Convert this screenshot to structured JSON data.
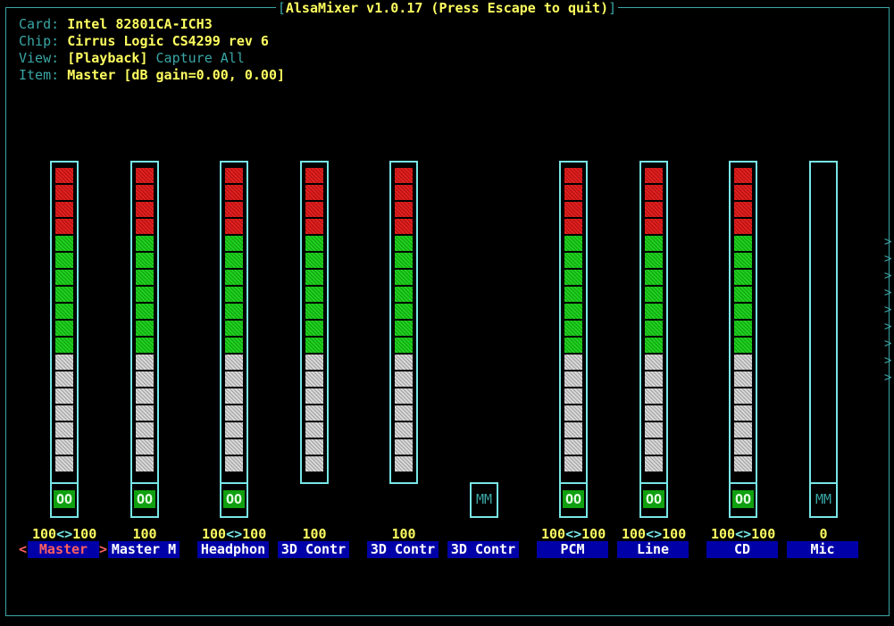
{
  "window": {
    "title": "AlsaMixer v1.0.17 (Press Escape to quit)"
  },
  "info": {
    "card_label": "Card:",
    "card_value": "Intel 82801CA-ICH3",
    "chip_label": "Chip:",
    "chip_value": "Cirrus Logic CS4299 rev 6",
    "view_label": "View:",
    "view_active": "[Playback]",
    "view_capture": "Capture",
    "view_all": "All",
    "item_label": "Item:",
    "item_value": "Master [dB gain=0.00, 0.00]"
  },
  "colors": {
    "border": "#78e6e6",
    "red": "#e02020",
    "green": "#20d020",
    "white": "#d8d8d8",
    "name_bg": "#0000a8",
    "text_yellow": "#ffff60",
    "selected_name": "#ff6060"
  },
  "controls": [
    {
      "name": "Master",
      "volume": "100<>100",
      "level": 1.0,
      "switch": "OO",
      "has_bar": true,
      "selected": true
    },
    {
      "name": "Master M",
      "volume": "100",
      "level": 1.0,
      "switch": "OO",
      "has_bar": true
    },
    {
      "name": "Headphon",
      "volume": "100<>100",
      "level": 1.0,
      "switch": "OO",
      "has_bar": true
    },
    {
      "name": "3D Contr",
      "volume": "100",
      "level": 1.0,
      "switch": "",
      "has_bar": true
    },
    {
      "name": "3D Contr",
      "volume": "100",
      "level": 1.0,
      "switch": "",
      "has_bar": true
    },
    {
      "name": "3D Contr",
      "volume": "",
      "level": 0,
      "switch": "MM",
      "has_bar": false
    },
    {
      "name": "PCM",
      "volume": "100<>100",
      "level": 1.0,
      "switch": "OO",
      "has_bar": true
    },
    {
      "name": "Line",
      "volume": "100<>100",
      "level": 1.0,
      "switch": "OO",
      "has_bar": true
    },
    {
      "name": "CD",
      "volume": "100<>100",
      "level": 1.0,
      "switch": "OO",
      "has_bar": true
    },
    {
      "name": "Mic",
      "volume": "0",
      "level": 0,
      "switch": "MM",
      "has_bar": true
    }
  ],
  "nav": {
    "left_marker": "<",
    "right_marker": ">",
    "scroll_marker": ">"
  }
}
